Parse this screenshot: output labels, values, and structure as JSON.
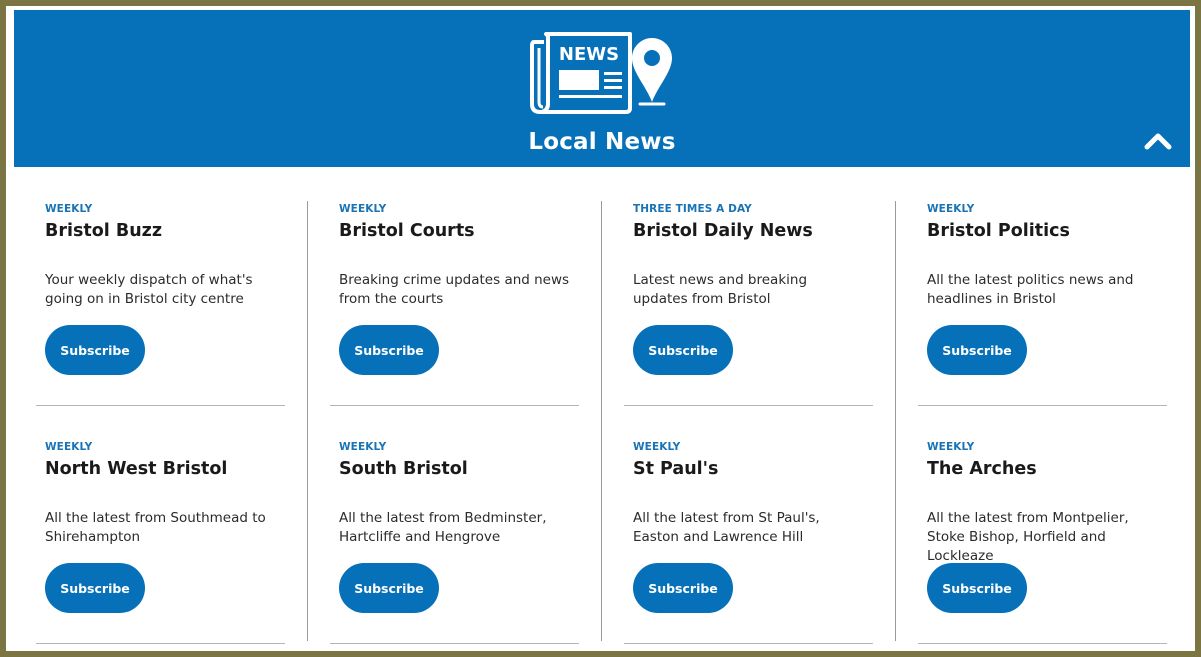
{
  "header": {
    "logo_icon": "newspaper-with-location-pin-icon",
    "logo_text": "NEWS",
    "title": "Local News",
    "collapse_icon": "chevron-up-icon"
  },
  "colors": {
    "brand_blue": "#0670b8",
    "frequency_blue": "#1a73b5",
    "page_border": "#7a7543"
  },
  "newsletters": [
    {
      "frequency": "WEEKLY",
      "title": "Bristol Buzz",
      "description": "Your weekly dispatch of what's going on in Bristol city centre",
      "button": "Subscribe"
    },
    {
      "frequency": "WEEKLY",
      "title": "Bristol Courts",
      "description": "Breaking crime updates and news from the courts",
      "button": "Subscribe"
    },
    {
      "frequency": "THREE TIMES A DAY",
      "title": "Bristol Daily News",
      "description": "Latest news and breaking updates from Bristol",
      "button": "Subscribe"
    },
    {
      "frequency": "WEEKLY",
      "title": "Bristol Politics",
      "description": "All the latest politics news and headlines in Bristol",
      "button": "Subscribe"
    },
    {
      "frequency": "WEEKLY",
      "title": "North West Bristol",
      "description": "All the latest from Southmead to Shirehampton",
      "button": "Subscribe"
    },
    {
      "frequency": "WEEKLY",
      "title": "South Bristol",
      "description": "All the latest from Bedminster, Hartcliffe and Hengrove",
      "button": "Subscribe"
    },
    {
      "frequency": "WEEKLY",
      "title": "St Paul's",
      "description": "All the latest from St Paul's, Easton and Lawrence Hill",
      "button": "Subscribe"
    },
    {
      "frequency": "WEEKLY",
      "title": "The Arches",
      "description": "All the latest from Montpelier, Stoke Bishop, Horfield and Lockleaze",
      "button": "Subscribe"
    }
  ]
}
